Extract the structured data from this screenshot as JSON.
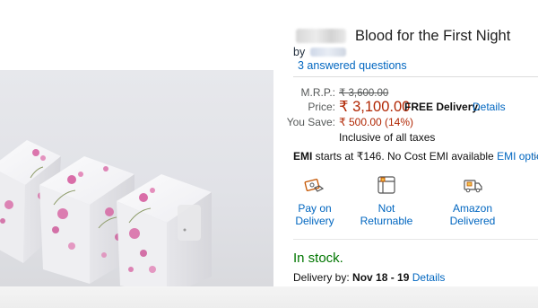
{
  "product": {
    "title": "Blood for the First Night",
    "by_label": "by",
    "answered_questions": "3 answered questions"
  },
  "pricing": {
    "mrp_label": "M.R.P.:",
    "mrp_value": "₹ 3,600.00",
    "price_label": "Price:",
    "price_value": "₹ 3,100.00",
    "free_delivery": "FREE Delivery.",
    "details_link": "Details",
    "save_label": "You Save:",
    "save_value": "₹ 500.00 (14%)",
    "taxes_note": "Inclusive of all taxes"
  },
  "emi": {
    "prefix": "EMI",
    "text": " starts at ₹146. No Cost EMI available ",
    "options_link": "EMI options"
  },
  "features": [
    {
      "line1": "Pay on",
      "line2": "Delivery",
      "icon": "cash-on-delivery-icon"
    },
    {
      "line1": "Not",
      "line2": "Returnable",
      "icon": "not-returnable-icon"
    },
    {
      "line1": "Amazon",
      "line2": "Delivered",
      "icon": "delivery-truck-icon"
    }
  ],
  "stock": {
    "status": "In stock."
  },
  "delivery": {
    "label": "Delivery by: ",
    "dates": "Nov 18 - 19",
    "details_link": "Details"
  },
  "colors": {
    "link": "#0066c0",
    "price_red": "#b12704",
    "in_stock_green": "#007600",
    "icon_orange": "#c45500",
    "flower_pink": "#d4559a"
  }
}
